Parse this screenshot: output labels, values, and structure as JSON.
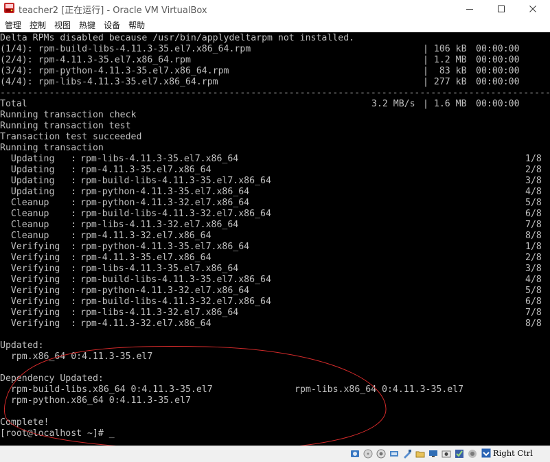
{
  "window": {
    "title": "teacher2 [正在运行] - Oracle VM VirtualBox",
    "icon": "virtualbox-icon"
  },
  "menu": {
    "items": [
      {
        "label": "管理"
      },
      {
        "label": "控制"
      },
      {
        "label": "视图"
      },
      {
        "label": "热键"
      },
      {
        "label": "设备"
      },
      {
        "label": "帮助"
      }
    ]
  },
  "console": {
    "download": {
      "header": "Delta RPMs disabled because /usr/bin/applydeltarpm not installed.",
      "rows": [
        {
          "name": "(1/4): rpm-build-libs-4.11.3-35.el7.x86_64.rpm",
          "size": "| 106 kB",
          "time": "00:00:00"
        },
        {
          "name": "(2/4): rpm-4.11.3-35.el7.x86_64.rpm",
          "size": "| 1.2 MB",
          "time": "00:00:00"
        },
        {
          "name": "(3/4): rpm-python-4.11.3-35.el7.x86_64.rpm",
          "size": "|  83 kB",
          "time": "00:00:00"
        },
        {
          "name": "(4/4): rpm-libs-4.11.3-35.el7.x86_64.rpm",
          "size": "| 277 kB",
          "time": "00:00:00"
        }
      ],
      "separator": "--------------------------------------------------------------------------------------------------------",
      "total": {
        "label": "Total",
        "speed": "3.2 MB/s",
        "size": "| 1.6 MB",
        "time": "00:00:00"
      }
    },
    "transaction_lines": [
      "Running transaction check",
      "Running transaction test",
      "Transaction test succeeded",
      "Running transaction"
    ],
    "steps": [
      {
        "action": "  Updating   :",
        "pkg": "rpm-libs-4.11.3-35.el7.x86_64",
        "count": "1/8"
      },
      {
        "action": "  Updating   :",
        "pkg": "rpm-4.11.3-35.el7.x86_64",
        "count": "2/8"
      },
      {
        "action": "  Updating   :",
        "pkg": "rpm-build-libs-4.11.3-35.el7.x86_64",
        "count": "3/8"
      },
      {
        "action": "  Updating   :",
        "pkg": "rpm-python-4.11.3-35.el7.x86_64",
        "count": "4/8"
      },
      {
        "action": "  Cleanup    :",
        "pkg": "rpm-python-4.11.3-32.el7.x86_64",
        "count": "5/8"
      },
      {
        "action": "  Cleanup    :",
        "pkg": "rpm-build-libs-4.11.3-32.el7.x86_64",
        "count": "6/8"
      },
      {
        "action": "  Cleanup    :",
        "pkg": "rpm-libs-4.11.3-32.el7.x86_64",
        "count": "7/8"
      },
      {
        "action": "  Cleanup    :",
        "pkg": "rpm-4.11.3-32.el7.x86_64",
        "count": "8/8"
      },
      {
        "action": "  Verifying  :",
        "pkg": "rpm-python-4.11.3-35.el7.x86_64",
        "count": "1/8"
      },
      {
        "action": "  Verifying  :",
        "pkg": "rpm-4.11.3-35.el7.x86_64",
        "count": "2/8"
      },
      {
        "action": "  Verifying  :",
        "pkg": "rpm-libs-4.11.3-35.el7.x86_64",
        "count": "3/8"
      },
      {
        "action": "  Verifying  :",
        "pkg": "rpm-build-libs-4.11.3-35.el7.x86_64",
        "count": "4/8"
      },
      {
        "action": "  Verifying  :",
        "pkg": "rpm-python-4.11.3-32.el7.x86_64",
        "count": "5/8"
      },
      {
        "action": "  Verifying  :",
        "pkg": "rpm-build-libs-4.11.3-32.el7.x86_64",
        "count": "6/8"
      },
      {
        "action": "  Verifying  :",
        "pkg": "rpm-libs-4.11.3-32.el7.x86_64",
        "count": "7/8"
      },
      {
        "action": "  Verifying  :",
        "pkg": "rpm-4.11.3-32.el7.x86_64",
        "count": "8/8"
      }
    ],
    "updated": {
      "label": "Updated:",
      "items": [
        "  rpm.x86_64 0:4.11.3-35.el7"
      ]
    },
    "dependency_updated": {
      "label": "Dependency Updated:",
      "items": [
        "  rpm-build-libs.x86_64 0:4.11.3-35.el7",
        "rpm-libs.x86_64 0:4.11.3-35.el7",
        "  rpm-python.x86_64 0:4.11.3-35.el7"
      ]
    },
    "complete": "Complete!",
    "prompt": "[root@localhost ~]# ",
    "cursor": "_"
  },
  "annotation": {
    "color": "#d42a2a"
  },
  "statusbar": {
    "icons": [
      "hard-disk-icon",
      "optical-drive-icon",
      "audio-icon",
      "network-icon",
      "usb-icon",
      "shared-folder-icon",
      "display-icon",
      "video-capture-icon",
      "virtualization-icon",
      "mouse-integration-icon"
    ],
    "host_key": "Right Ctrl"
  },
  "colors": {
    "console_bg": "#000000",
    "console_fg": "#c0c0c0"
  }
}
